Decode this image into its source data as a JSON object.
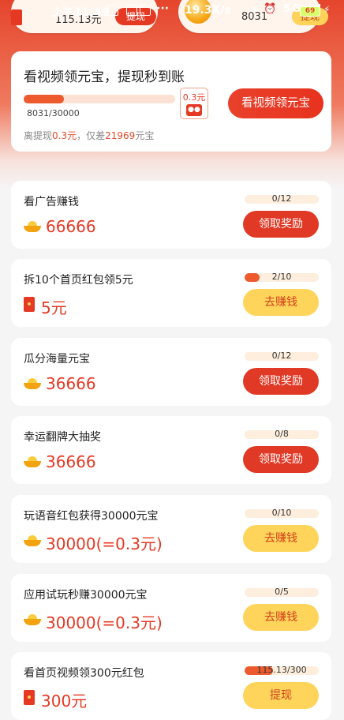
{
  "status_bar": {
    "time": "上午11:49",
    "dots": "···",
    "speed": "19.3K/s",
    "icons": "⚹ ⏰ 5G.ıll",
    "battery": "69",
    "bolt": "⚡"
  },
  "top_row": {
    "left_value": "115.13元",
    "left_button": "提现",
    "right_value": "8031",
    "right_button": "提现"
  },
  "header": {
    "title": "看视频领元宝，提现秒到账",
    "progress_text": "8031/30000",
    "progress_fraction": 0.268,
    "target_value": "0.3元",
    "button": "看视频领元宝",
    "note_prefix": "离提现",
    "note_amount": "0.3元",
    "note_mid": "，仅差",
    "note_gap": "21969",
    "note_suffix": "元宝"
  },
  "tasks": [
    {
      "title": "看广告赚钱",
      "reward_icon": "ingot-icon",
      "reward": "66666",
      "progress": "0/12",
      "fraction": 0,
      "button": "领取奖励",
      "button_style": "red"
    },
    {
      "title": "拆10个首页红包领5元",
      "reward_icon": "red-packet-icon",
      "reward": "5元",
      "progress": "2/10",
      "fraction": 0.2,
      "button": "去赚钱",
      "button_style": "yellow"
    },
    {
      "title": "瓜分海量元宝",
      "reward_icon": "ingot-icon",
      "reward": "36666",
      "progress": "0/12",
      "fraction": 0,
      "button": "领取奖励",
      "button_style": "red"
    },
    {
      "title": "幸运翻牌大抽奖",
      "reward_icon": "ingot-icon",
      "reward": "36666",
      "progress": "0/8",
      "fraction": 0,
      "button": "领取奖励",
      "button_style": "red"
    },
    {
      "title": "玩语音红包获得30000元宝",
      "reward_icon": "ingot-icon",
      "reward": "30000(=0.3元)",
      "progress": "0/10",
      "fraction": 0,
      "button": "去赚钱",
      "button_style": "yellow"
    },
    {
      "title": "应用试玩秒赚30000元宝",
      "reward_icon": "ingot-icon",
      "reward": "30000(=0.3元)",
      "progress": "0/5",
      "fraction": 0,
      "button": "去赚钱",
      "button_style": "yellow"
    },
    {
      "title": "看首页视频领300元红包",
      "reward_icon": "red-packet-icon",
      "reward": "300元",
      "progress": "115.13/300",
      "fraction": 0.38,
      "button": "提现",
      "button_style": "yellow"
    }
  ],
  "colors": {
    "accent_red": "#e53924",
    "button_yellow": "#ffd45a",
    "progress_fill": "#ec5a2e"
  }
}
